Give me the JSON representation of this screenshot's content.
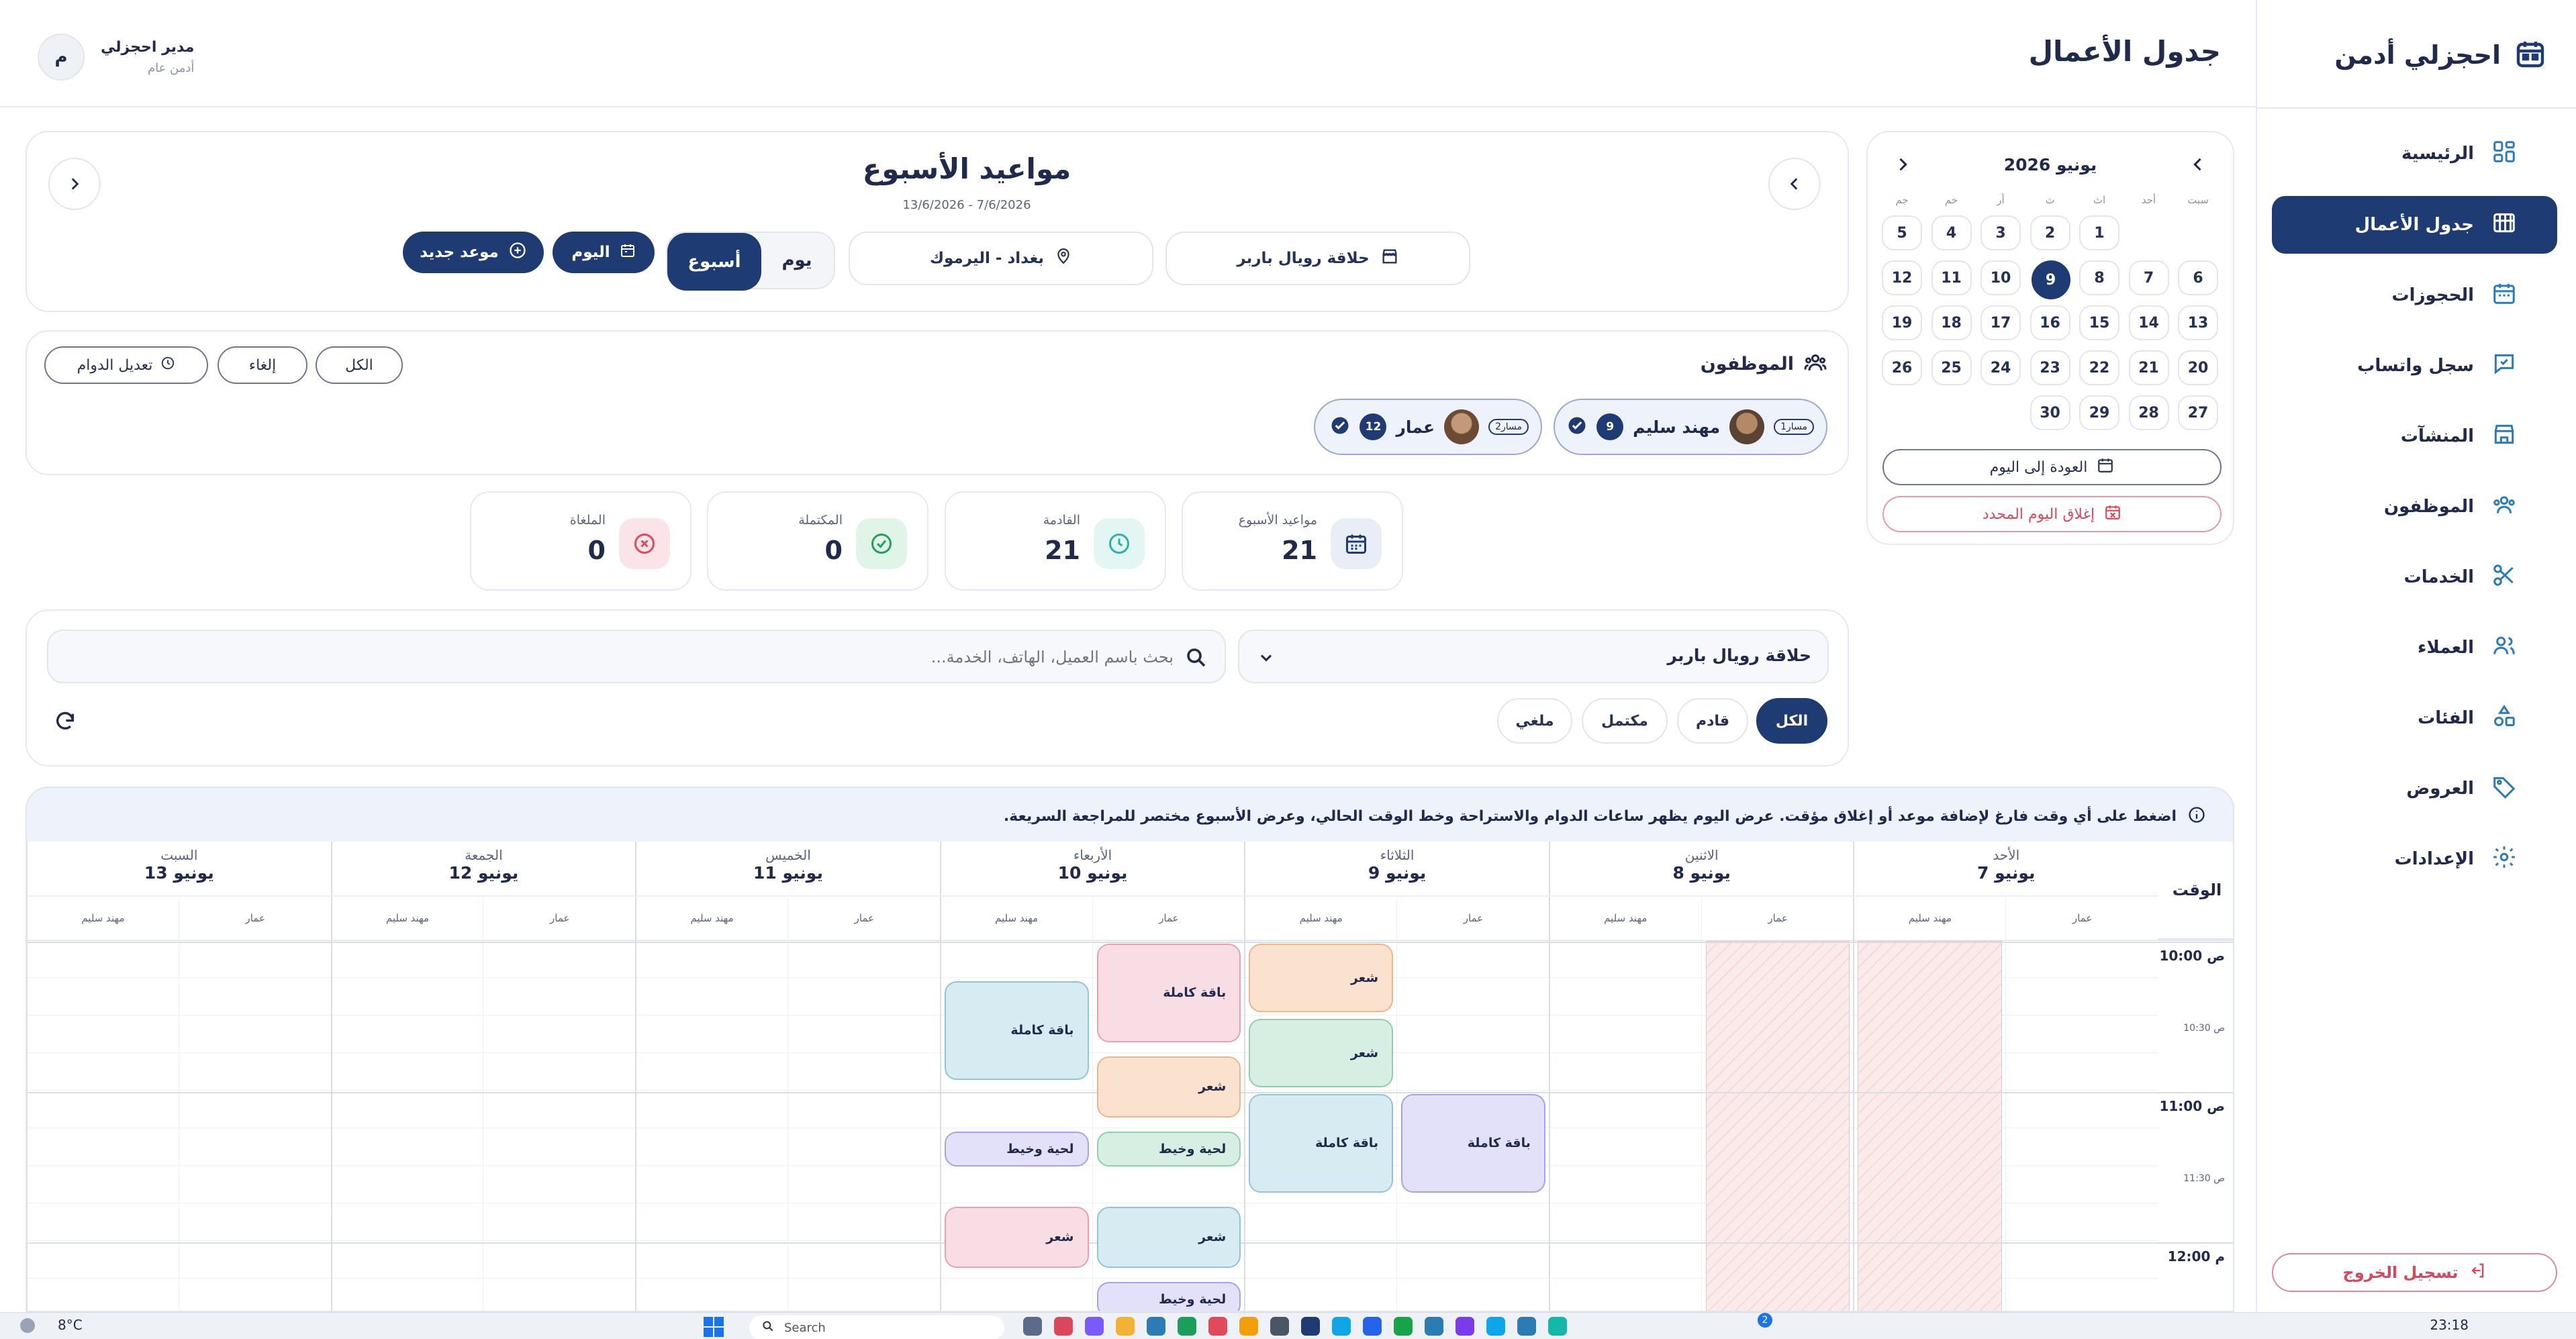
{
  "sidebar": {
    "brand": "احجزلي أدمن",
    "items": [
      {
        "label": "الرئيسية",
        "icon": "dashboard-icon"
      },
      {
        "label": "جدول الأعمال",
        "icon": "schedule-icon",
        "active": true
      },
      {
        "label": "الحجوزات",
        "icon": "calendar-icon"
      },
      {
        "label": "سجل واتساب",
        "icon": "chat-icon"
      },
      {
        "label": "المنشآت",
        "icon": "store-icon"
      },
      {
        "label": "الموظفون",
        "icon": "staff-icon"
      },
      {
        "label": "الخدمات",
        "icon": "scissors-icon"
      },
      {
        "label": "العملاء",
        "icon": "customers-icon"
      },
      {
        "label": "الفئات",
        "icon": "categories-icon"
      },
      {
        "label": "العروض",
        "icon": "tag-icon"
      },
      {
        "label": "الإعدادات",
        "icon": "gear-icon"
      }
    ],
    "logout": "تسجيل الخروج"
  },
  "header": {
    "title": "جدول الأعمال",
    "user_name": "مدير احجزلي",
    "user_role": "أدمن عام",
    "avatar_letter": "م"
  },
  "mini_calendar": {
    "month": "يونيو 2026",
    "weekdays": [
      "سبت",
      "أحد",
      "اث",
      "ث",
      "أر",
      "خم",
      "جم"
    ],
    "rows": [
      [
        "",
        "",
        "1",
        "2",
        "3",
        "4",
        "5"
      ],
      [
        "6",
        "7",
        "8",
        "9",
        "10",
        "11",
        "12"
      ],
      [
        "13",
        "14",
        "15",
        "16",
        "17",
        "18",
        "19"
      ],
      [
        "20",
        "21",
        "22",
        "23",
        "24",
        "25",
        "26"
      ],
      [
        "27",
        "28",
        "29",
        "30",
        "",
        "",
        ""
      ]
    ],
    "selected": "9",
    "back_today": "العودة إلى اليوم",
    "close_day": "إغلاق اليوم المحدد"
  },
  "week_header": {
    "title": "مواعيد الأسبوع",
    "range": "13/6/2026 - 7/6/2026",
    "venue": "حلاقة رويال باربر",
    "location": "بغداد - اليرموك",
    "view_day": "يوم",
    "view_week": "أسبوع",
    "today_button": "اليوم",
    "new_button": "موعد جديد"
  },
  "employees": {
    "title": "الموظفون",
    "filters": {
      "all": "الكل",
      "cancel": "إلغاء",
      "edit_hours": "تعديل الدوام"
    },
    "list": [
      {
        "name": "مهند سليم",
        "lane": "مسار1",
        "count": "9"
      },
      {
        "name": "عمار",
        "lane": "مسار2",
        "count": "12"
      }
    ]
  },
  "stats": [
    {
      "label": "مواعيد الأسبوع",
      "value": "21",
      "icon": "calendar-icon",
      "color": "#1f3b73"
    },
    {
      "label": "القادمة",
      "value": "21",
      "icon": "clock-icon",
      "color": "#2bb3a7"
    },
    {
      "label": "المكتملة",
      "value": "0",
      "icon": "check-circle-icon",
      "color": "#22a05a"
    },
    {
      "label": "الملغاة",
      "value": "0",
      "icon": "x-circle-icon",
      "color": "#e04a5a"
    }
  ],
  "filters": {
    "venue_select": "حلاقة رويال باربر",
    "search_placeholder": "بحث باسم العميل، الهاتف، الخدمة...",
    "status": [
      "الكل",
      "قادم",
      "مكتمل",
      "ملغي"
    ]
  },
  "schedule": {
    "hint": "اضغط على أي وقت فارغ لإضافة موعد أو إغلاق مؤقت. عرض اليوم يظهر ساعات الدوام والاستراحة وخط الوقت الحالي، وعرض الأسبوع مختصر للمراجعة السريعة.",
    "time_label": "الوقت",
    "days": [
      {
        "name": "الأحد",
        "date": "7 يونيو"
      },
      {
        "name": "الاثنين",
        "date": "8 يونيو"
      },
      {
        "name": "الثلاثاء",
        "date": "9 يونيو"
      },
      {
        "name": "الأربعاء",
        "date": "10 يونيو"
      },
      {
        "name": "الخميس",
        "date": "11 يونيو"
      },
      {
        "name": "الجمعة",
        "date": "12 يونيو"
      },
      {
        "name": "السبت",
        "date": "13 يونيو"
      }
    ],
    "staff_cols": [
      "عمار",
      "مهند سليم"
    ],
    "times": [
      {
        "label": "10:00 ص",
        "major": true
      },
      {
        "label": "10:30 ص",
        "major": false
      },
      {
        "label": "11:00 ص",
        "major": true
      },
      {
        "label": "11:30 ص",
        "major": false
      },
      {
        "label": "12:00 م",
        "major": true
      }
    ],
    "appointments": [
      {
        "label": "شعر",
        "day": 2,
        "staff": 1,
        "start": 0,
        "dur": 1,
        "color": "#fbe2cf",
        "border": "#f0b48a"
      },
      {
        "label": "شعر",
        "day": 2,
        "staff": 1,
        "start": 1,
        "dur": 1,
        "color": "#d7efe2",
        "border": "#8fcfab"
      },
      {
        "label": "باقة كاملة",
        "day": 2,
        "staff": 1,
        "start": 2,
        "dur": 1.4,
        "color": "#d7ecf2",
        "border": "#8fc5d6"
      },
      {
        "label": "باقة كاملة",
        "day": 2,
        "staff": 0,
        "start": 2,
        "dur": 1.4,
        "color": "#e3e0fa",
        "border": "#a8a0e8"
      },
      {
        "label": "باقة كاملة",
        "day": 3,
        "staff": 0,
        "start": 0,
        "dur": 1.4,
        "color": "#f9dde5",
        "border": "#e9a0b4"
      },
      {
        "label": "باقة كاملة",
        "day": 3,
        "staff": 1,
        "start": 0.5,
        "dur": 1.4,
        "color": "#d7ecf2",
        "border": "#8fc5d6"
      },
      {
        "label": "شعر",
        "day": 3,
        "staff": 0,
        "start": 1.5,
        "dur": 0.9,
        "color": "#fbe2cf",
        "border": "#f0b48a"
      },
      {
        "label": "لحية وخيط",
        "day": 3,
        "staff": 0,
        "start": 2.5,
        "dur": 0.55,
        "color": "#d7efe2",
        "border": "#8fcfab"
      },
      {
        "label": "لحية وخيط",
        "day": 3,
        "staff": 1,
        "start": 2.5,
        "dur": 0.55,
        "color": "#e3e0fa",
        "border": "#a8a0e8"
      },
      {
        "label": "شعر",
        "day": 3,
        "staff": 0,
        "start": 3.5,
        "dur": 0.9,
        "color": "#d7ecf2",
        "border": "#8fc5d6"
      },
      {
        "label": "شعر",
        "day": 3,
        "staff": 1,
        "start": 3.5,
        "dur": 0.9,
        "color": "#f9dde5",
        "border": "#e9a0b4"
      },
      {
        "label": "لحية وخيط",
        "day": 3,
        "staff": 0,
        "start": 4.5,
        "dur": 0.55,
        "color": "#e3e0fa",
        "border": "#a8a0e8"
      }
    ]
  },
  "taskbar": {
    "weather": "8°C",
    "search": "Search",
    "time": "23:18",
    "badge": "2"
  }
}
